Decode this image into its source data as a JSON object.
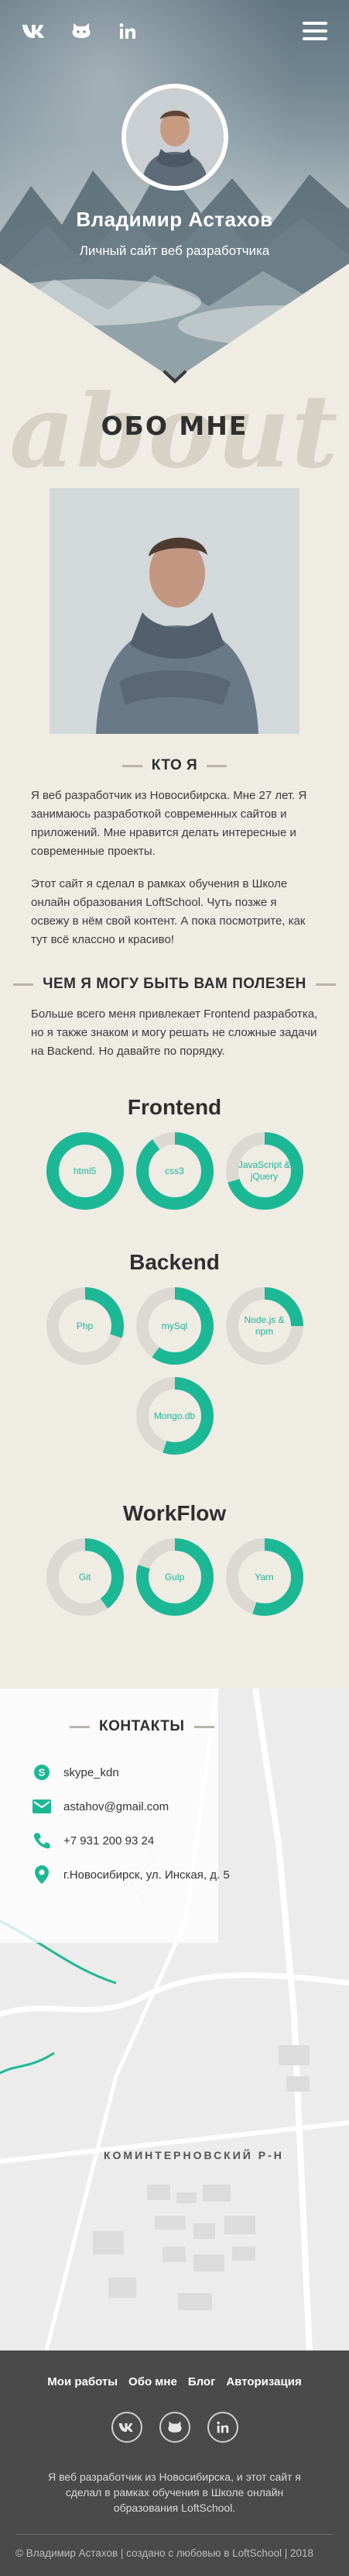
{
  "header": {
    "social": [
      {
        "icon": "vk-icon"
      },
      {
        "icon": "github-icon"
      },
      {
        "icon": "linkedin-icon"
      }
    ],
    "menu_icon": "burger-menu-icon",
    "name": "Владимир Астахов",
    "subtitle": "Личный сайт веб разработчика",
    "down_icon": "chevron-down-icon"
  },
  "about": {
    "bg_word": "about",
    "title": "ОБО МНЕ",
    "who_heading": "КТО Я",
    "who_paragraphs": [
      "Я веб разработчик из Новосибирска. Мне 27 лет. Я занимаюсь разработкой современных сайтов и приложений. Мне нравится делать интересные и современные проекты.",
      "Этот сайт я сделал в рамках обучения в Школе онлайн образования LoftSchool. Чуть позже я освежу в нём свой контент. А пока посмотрите, как тут всё классно и красиво!"
    ],
    "useful_heading": "ЧЕМ Я МОГУ БЫТЬ ВАМ ПОЛЕЗЕН",
    "useful_paragraph": "Больше всего меня привлекает Frontend разработка, но я также знаком и могу решать не сложные задачи на Backend. Но давайте по порядку."
  },
  "skills": [
    {
      "title": "Frontend",
      "items": [
        {
          "label": "html5",
          "percent": 100
        },
        {
          "label": "css3",
          "percent": 90
        },
        {
          "label": "JavaScript & jQuery",
          "percent": 70
        }
      ]
    },
    {
      "title": "Backend",
      "items": [
        {
          "label": "Php",
          "percent": 30
        },
        {
          "label": "mySql",
          "percent": 60
        },
        {
          "label": "Node.js & npm",
          "percent": 25
        },
        {
          "label": "Mongo.db",
          "percent": 55
        }
      ]
    },
    {
      "title": "WorkFlow",
      "items": [
        {
          "label": "Git",
          "percent": 40
        },
        {
          "label": "Gulp",
          "percent": 80
        },
        {
          "label": "Yarn",
          "percent": 55
        }
      ]
    }
  ],
  "contacts": {
    "heading": "КОНТАКТЫ",
    "items": [
      {
        "icon": "skype-icon",
        "text": "skype_kdn"
      },
      {
        "icon": "mail-icon",
        "text": "astahov@gmail.com"
      },
      {
        "icon": "phone-icon",
        "text": "+7 931 200 93 24"
      },
      {
        "icon": "location-pin-icon",
        "text": "г.Новосибирск, ул. Инская, д. 5"
      }
    ],
    "district": "КОМИНТЕРНОВСКИЙ Р-Н"
  },
  "footer": {
    "nav": [
      "Мои работы",
      "Обо мне",
      "Блог",
      "Авторизация"
    ],
    "social": [
      "vk-icon",
      "github-icon",
      "linkedin-icon"
    ],
    "about": "Я веб разработчик из Новосибирска, и этот сайт я сделал в рамках обучения в Школе онлайн образования LoftSchool.",
    "copyright": "© Владимир Астахов | создано с любовью в LoftSchool | 2018"
  },
  "colors": {
    "accent": "#1cb896",
    "ring_bg": "#dcd9d2",
    "page_bg": "#efece4"
  }
}
